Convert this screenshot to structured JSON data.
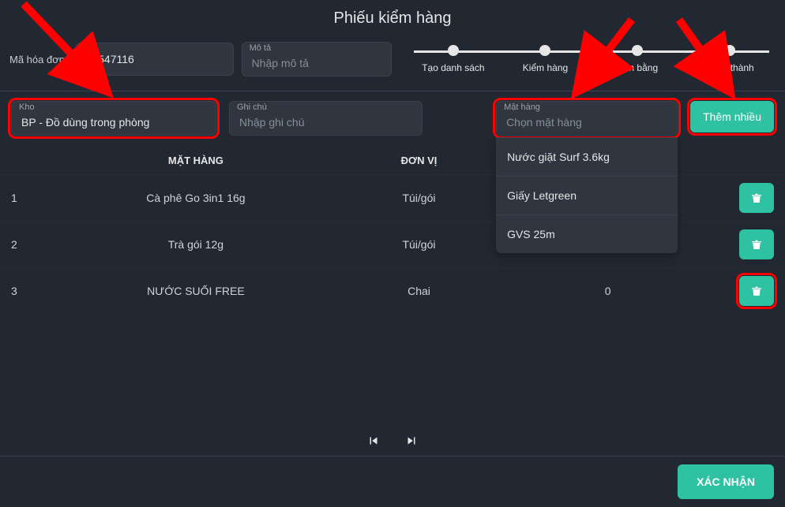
{
  "title": "Phiếu kiểm hàng",
  "order_code_label": "Mã hóa đơn:",
  "order_code": {
    "value": "26547116"
  },
  "description": {
    "label": "Mô tả",
    "placeholder": "Nhập mô tả",
    "value": ""
  },
  "stepper": [
    {
      "label": "Tạo danh sách"
    },
    {
      "label": "Kiểm hàng"
    },
    {
      "label": "Cân bằng"
    },
    {
      "label": "Hoàn thành"
    }
  ],
  "warehouse": {
    "label": "Kho",
    "value": "BP - Đồ dùng trong phòng"
  },
  "note": {
    "label": "Ghi chú",
    "placeholder": "Nhập ghi chú",
    "value": ""
  },
  "item_picker": {
    "label": "Mặt hàng",
    "placeholder": "Chọn mặt hàng",
    "value": "",
    "options": [
      "Nước giặt Surf 3.6kg",
      "Giấy Letgreen",
      "GVS 25m"
    ]
  },
  "add_many_label": "Thêm nhiều",
  "table": {
    "headers": {
      "item": "MẶT HÀNG",
      "unit": "ĐƠN VỊ"
    },
    "rows": [
      {
        "idx": "1",
        "name": "Cà phê Go 3in1 16g",
        "unit": "Túi/gói",
        "qty": ""
      },
      {
        "idx": "2",
        "name": "Trà gói 12g",
        "unit": "Túi/gói",
        "qty": ""
      },
      {
        "idx": "3",
        "name": "NƯỚC SUỐI FREE",
        "unit": "Chai",
        "qty": "0"
      }
    ]
  },
  "confirm_label": "XÁC NHẬN"
}
